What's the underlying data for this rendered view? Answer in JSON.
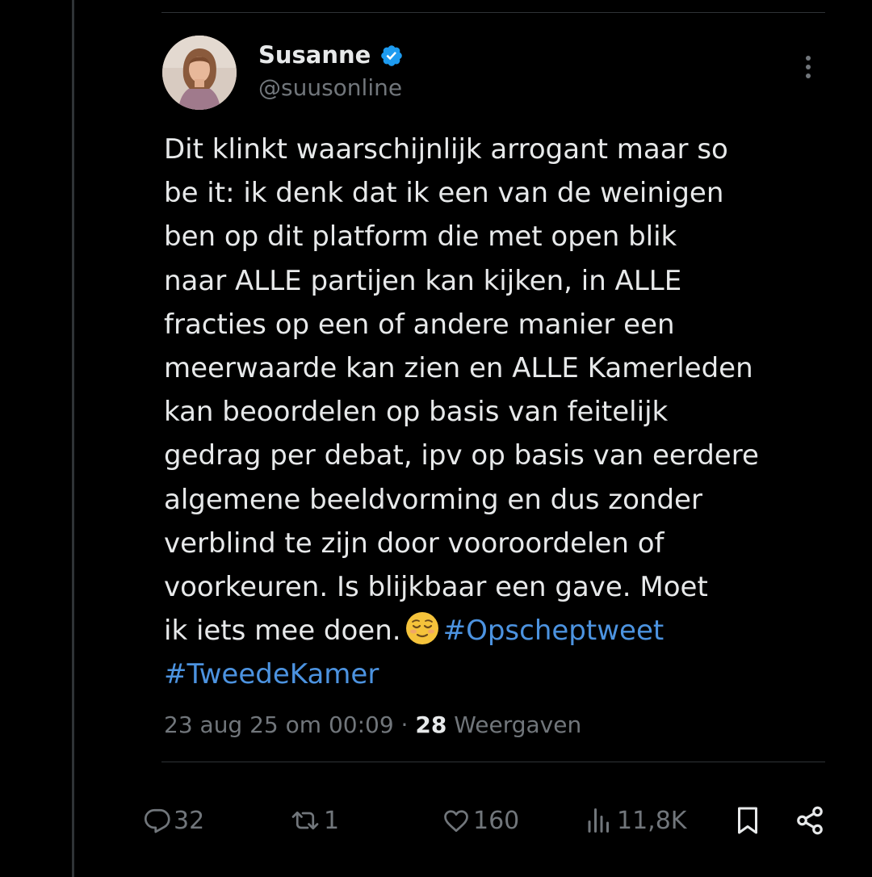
{
  "author": {
    "display_name": "Susanne",
    "handle": "@suusonline",
    "verified": true
  },
  "tweet": {
    "lines": [
      {
        "text": "Dit klinkt waarschijnlijk arrogant maar so"
      },
      {
        "text": "be it: ik denk dat ik een van de weinigen"
      },
      {
        "text": "ben op dit platform die met open blik"
      },
      {
        "text": "naar ALLE partijen kan kijken, in ALLE"
      },
      {
        "text": "fracties op een of andere manier een"
      },
      {
        "text": "meerwaarde kan zien en ALLE Kamerleden"
      },
      {
        "text": "kan beoordelen op basis van feitelijk"
      },
      {
        "text": "gedrag per debat, ipv op basis van eerdere"
      },
      {
        "text": "algemene beeldvorming en dus zonder"
      },
      {
        "text": "verblind te zijn door vooroordelen of"
      },
      {
        "text": "voorkeuren. Is blijkbaar een gave. Moet"
      }
    ],
    "last_line_text": "ik iets mee doen.",
    "emoji": "relieved-face",
    "hashtag_1": "#Opscheptweet",
    "hashtag_2": "#TweedeKamer"
  },
  "meta": {
    "timestamp": "23 aug 25 om 00:09",
    "separator": " · ",
    "views_count": "28",
    "views_label": " Weergaven"
  },
  "actions": {
    "replies": "32",
    "reposts": "1",
    "likes": "160",
    "views": "11,8K"
  },
  "colors": {
    "background": "#000000",
    "text": "#e7e9ea",
    "muted": "#71767b",
    "link": "#4c93e0",
    "verified": "#1d9bf0",
    "divider": "#2f3336"
  },
  "icons": [
    "verified-badge-icon",
    "more-options-icon",
    "reply-icon",
    "repost-icon",
    "like-icon",
    "views-icon",
    "bookmark-icon",
    "share-icon"
  ]
}
